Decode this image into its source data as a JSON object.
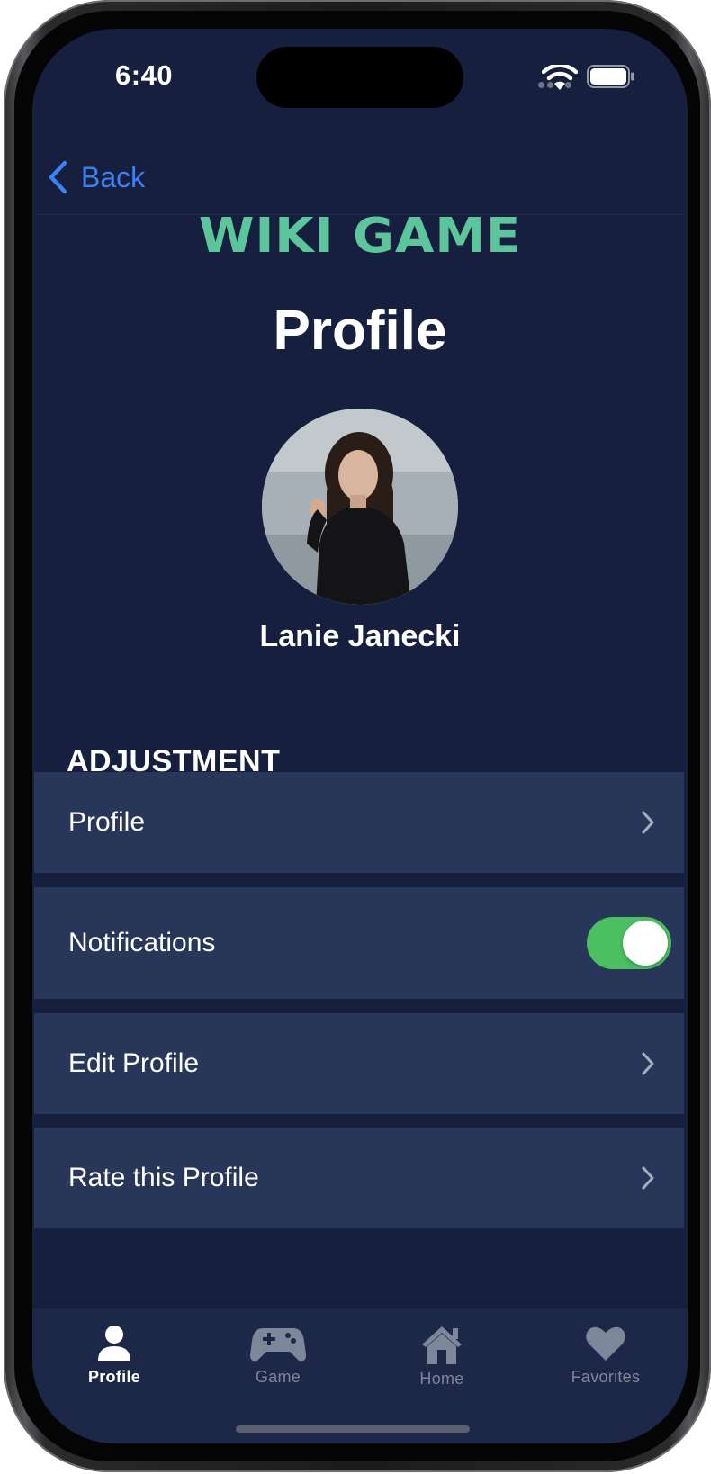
{
  "status_bar": {
    "time": "6:40"
  },
  "nav": {
    "back_label": "Back"
  },
  "header": {
    "logo": "WIKI GAME",
    "title": "Profile"
  },
  "user": {
    "name": "Lanie Janecki"
  },
  "section": {
    "title": "ADJUSTMENT",
    "rows": [
      {
        "label": "Profile",
        "accessory": "chevron"
      },
      {
        "label": "Notifications",
        "accessory": "toggle",
        "toggle_on": true
      },
      {
        "label": "Edit Profile",
        "accessory": "chevron"
      },
      {
        "label": "Rate this Profile",
        "accessory": "chevron"
      }
    ]
  },
  "tabbar": {
    "tabs": [
      {
        "label": "Profile",
        "icon": "person-icon",
        "active": true
      },
      {
        "label": "Game",
        "icon": "gamepad-icon",
        "active": false
      },
      {
        "label": "Home",
        "icon": "house-icon",
        "active": false
      },
      {
        "label": "Favorites",
        "icon": "heart-icon",
        "active": false
      }
    ]
  },
  "colors": {
    "background": "#161f3e",
    "row_background": "#273659",
    "tabbar_background": "#1d2748",
    "accent_blue": "#3b82f6",
    "logo_green": "#5cc59b",
    "toggle_green": "#4cbf61",
    "inactive_tab": "#7e8699"
  }
}
